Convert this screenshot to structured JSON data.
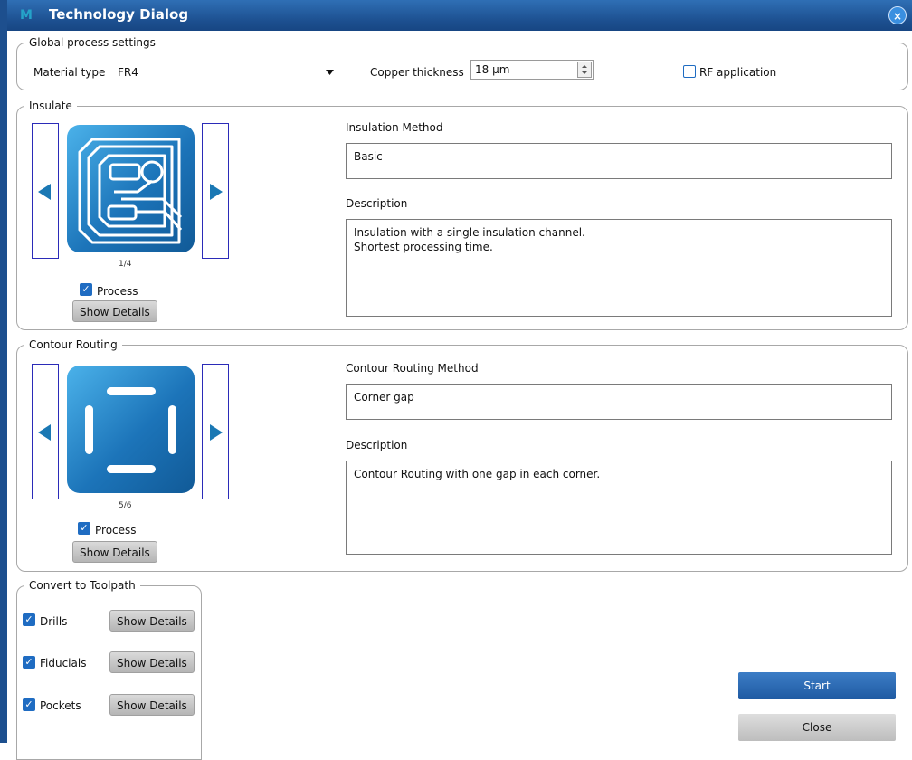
{
  "window": {
    "title": "Technology Dialog",
    "app_icon": "M",
    "close_glyph": "×"
  },
  "global": {
    "legend": "Global process settings",
    "material_label": "Material type",
    "material_value": "FR4",
    "copper_label": "Copper thickness",
    "copper_value": "18 µm",
    "rf_label": "RF application",
    "rf_checked": false
  },
  "insulate": {
    "legend": "Insulate",
    "page": "1/4",
    "process_label": "Process",
    "process_checked": true,
    "details_label": "Show Details",
    "method_label": "Insulation Method",
    "method_value": "Basic",
    "desc_label": "Description",
    "desc_line1": "Insulation with a single insulation channel.",
    "desc_line2": "Shortest processing time."
  },
  "contour": {
    "legend": "Contour Routing",
    "page": "5/6",
    "process_label": "Process",
    "process_checked": true,
    "details_label": "Show Details",
    "method_label": "Contour Routing Method",
    "method_value": "Corner gap",
    "desc_label": "Description",
    "desc_line1": "Contour Routing with one gap in each corner."
  },
  "convert": {
    "legend": "Convert to Toolpath",
    "items": [
      {
        "label": "Drills",
        "checked": true,
        "details_label": "Show Details"
      },
      {
        "label": "Fiducials",
        "checked": true,
        "details_label": "Show Details"
      },
      {
        "label": "Pockets",
        "checked": true,
        "details_label": "Show Details"
      }
    ]
  },
  "actions": {
    "start_label": "Start",
    "close_label": "Close"
  },
  "colors": {
    "accent": "#1f6cc2",
    "title_bar": "#1c4f8f",
    "nav_arrow": "#1a78b4"
  },
  "icons": {
    "nav_prev": "triangle-left-icon",
    "nav_next": "triangle-right-icon",
    "checkmark": "checkmark-icon",
    "spinner": "spinner-arrows-icon",
    "dropdown": "chevron-down-icon"
  }
}
